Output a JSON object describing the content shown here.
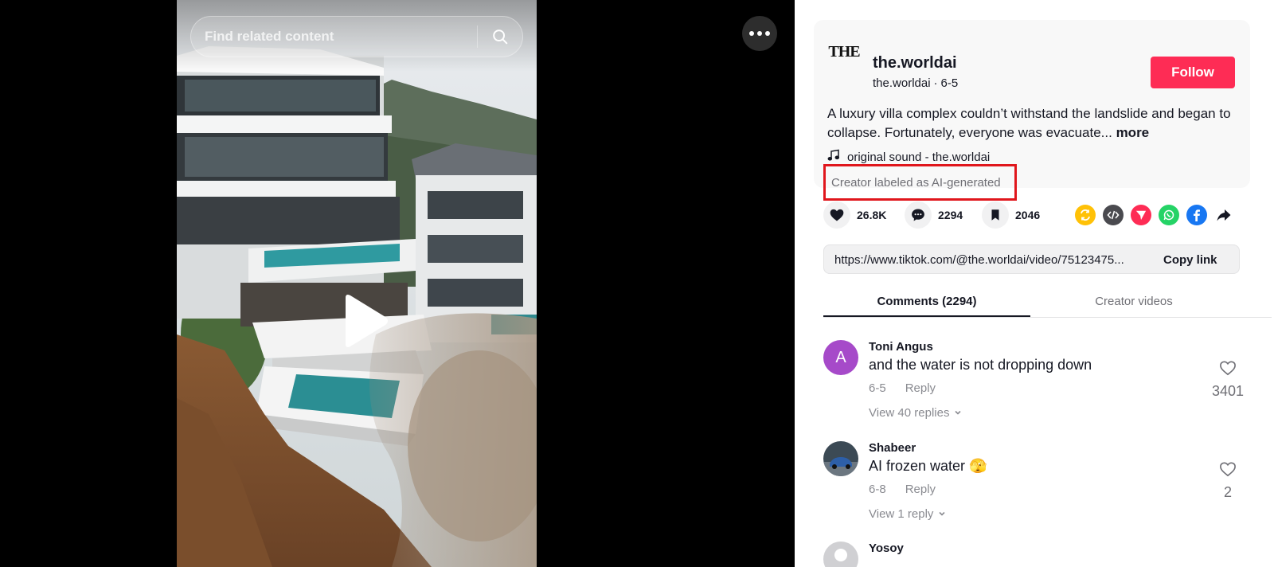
{
  "video": {
    "search_placeholder": "Find related content"
  },
  "author": {
    "avatar_text": "THE",
    "username": "the.worldai",
    "handle": "the.worldai",
    "separator": "·",
    "date": "6-5",
    "follow_label": "Follow"
  },
  "post": {
    "description": "A luxury villa complex couldn’t withstand the landslide and began to collapse. Fortunately, everyone was evacuate...",
    "more_label": "more",
    "sound": "original sound - the.worldai",
    "ai_label": "Creator labeled as AI-generated"
  },
  "stats": {
    "likes": "26.8K",
    "comments": "2294",
    "saves": "2046"
  },
  "share_icons": [
    "repost-icon",
    "embed-icon",
    "send-icon",
    "whatsapp-icon",
    "facebook-icon",
    "share-arrow-icon"
  ],
  "colors": {
    "accent": "#fe2c55",
    "highlight_box": "#e0161c",
    "repost": "#ffc107",
    "embed": "#4a4a4f",
    "send": "#fe2c55",
    "whatsapp": "#25d366",
    "facebook": "#1877f2"
  },
  "link": {
    "url": "https://www.tiktok.com/@the.worldai/video/75123475...",
    "copy_label": "Copy link"
  },
  "tabs": {
    "comments": "Comments (2294)",
    "creator_videos": "Creator videos"
  },
  "comments": [
    {
      "avatar_letter": "A",
      "name": "Toni Angus",
      "text": "and the water is not dropping down",
      "date": "6-5",
      "reply_label": "Reply",
      "view_replies": "View 40 replies",
      "likes": "3401"
    },
    {
      "name": "Shabeer",
      "text": "AI frozen water 🫣",
      "date": "6-8",
      "reply_label": "Reply",
      "view_replies": "View 1 reply",
      "likes": "2"
    },
    {
      "name": "Yosoy"
    }
  ]
}
